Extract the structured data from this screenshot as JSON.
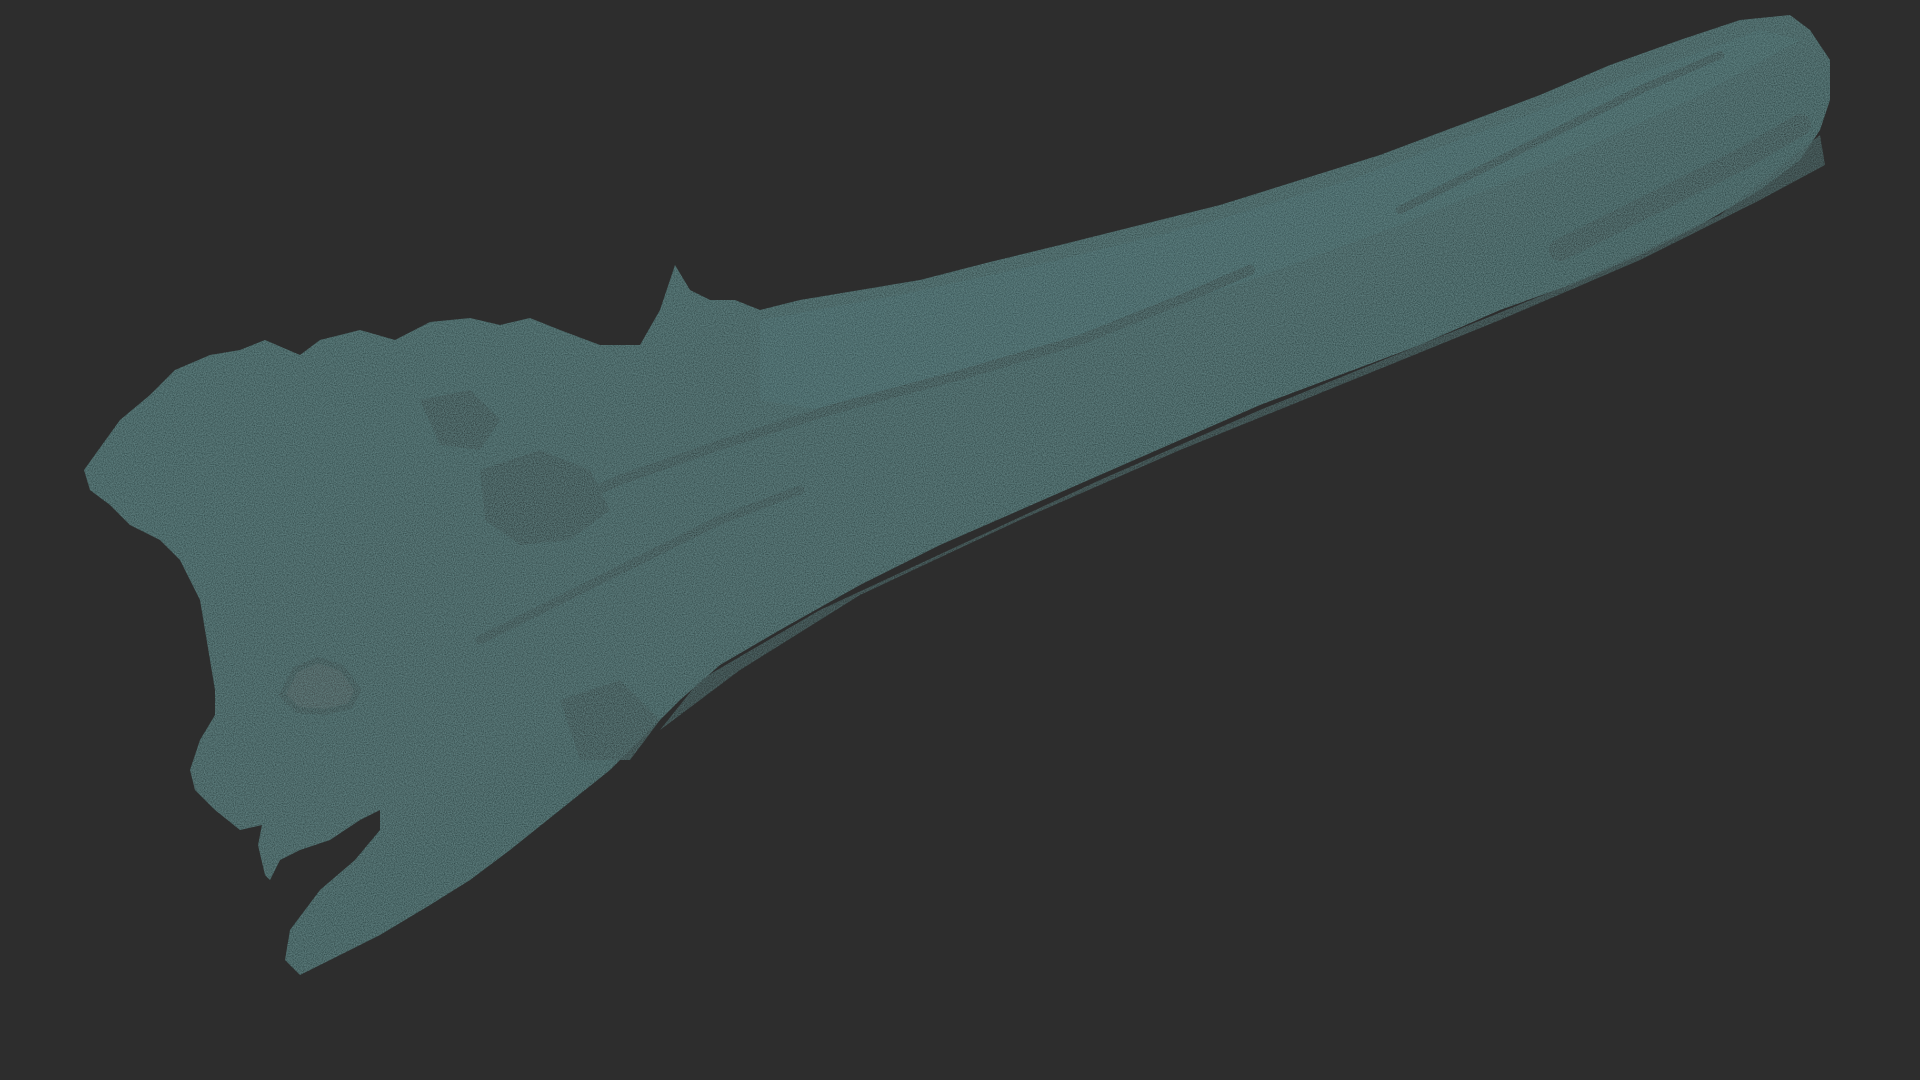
{
  "viewport": {
    "background_color": "#2d2d2d"
  },
  "model": {
    "object": "driftwood-log",
    "base_color": "#1c3333",
    "shadow_color": "#070b0b",
    "highlight_color": "#2b4a4a"
  }
}
